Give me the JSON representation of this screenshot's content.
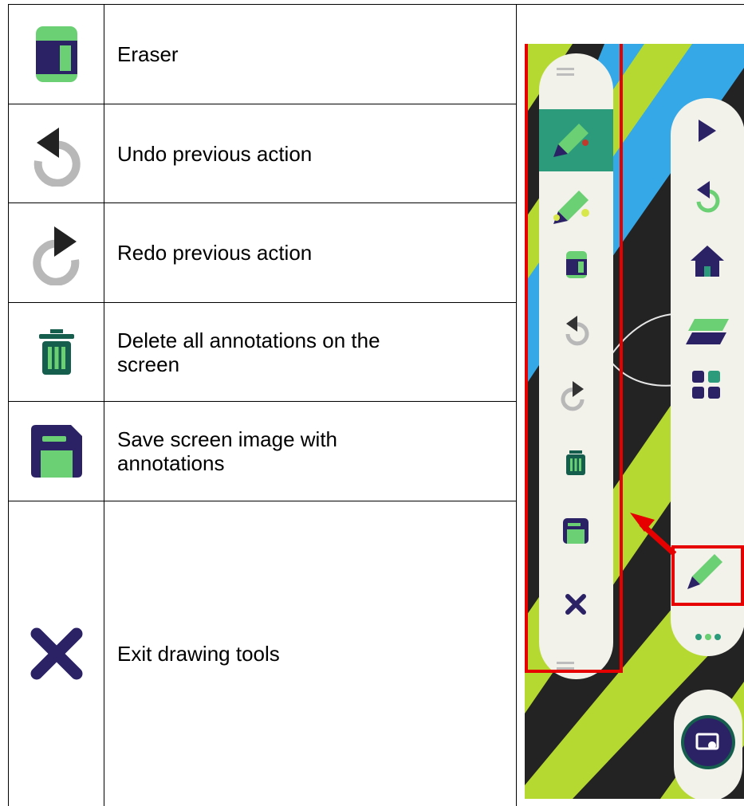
{
  "rows": [
    {
      "icon": "eraser-icon",
      "label": "Eraser"
    },
    {
      "icon": "undo-icon",
      "label": "Undo previous action"
    },
    {
      "icon": "redo-icon",
      "label": "Redo previous action"
    },
    {
      "icon": "trash-icon",
      "label_line1": "Delete all annotations on the",
      "label_line2": "screen"
    },
    {
      "icon": "save-icon",
      "label_line1": "Save screen image with",
      "label_line2": "annotations"
    },
    {
      "icon": "close-icon",
      "label": "Exit drawing tools"
    }
  ],
  "screenshot": {
    "drawing_toolbar": [
      "pen-icon",
      "highlighter-icon",
      "eraser-icon",
      "undo-icon",
      "redo-icon",
      "trash-icon",
      "save-icon",
      "close-icon"
    ],
    "main_toolbar": [
      "play-icon",
      "back-icon",
      "home-icon",
      "layers-icon",
      "apps-icon",
      "pen-icon",
      "more-icon",
      "screen-touch-icon"
    ],
    "colors": {
      "highlight": "#e60000",
      "navy": "#2b2266",
      "green": "#6bcf73",
      "teal": "#2b9b7b",
      "lime": "#b5d930",
      "sky": "#35a8e8"
    }
  }
}
